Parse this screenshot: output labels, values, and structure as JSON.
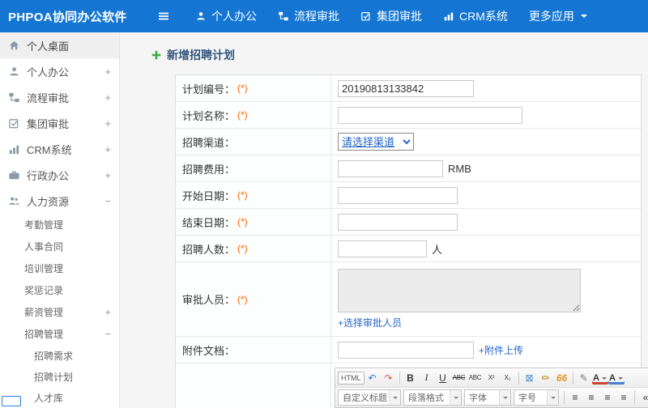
{
  "topbar": {
    "brand": "PHPOA协同办公软件",
    "nav": [
      {
        "label": "个人办公"
      },
      {
        "label": "流程审批"
      },
      {
        "label": "集团审批"
      },
      {
        "label": "CRM系统"
      },
      {
        "label": "更多应用"
      }
    ]
  },
  "sidebar": {
    "items": [
      {
        "label": "个人桌面",
        "expander": ""
      },
      {
        "label": "个人办公",
        "expander": "+"
      },
      {
        "label": "流程审批",
        "expander": "+"
      },
      {
        "label": "集团审批",
        "expander": "+"
      },
      {
        "label": "CRM系统",
        "expander": "+"
      },
      {
        "label": "行政办公",
        "expander": "+"
      },
      {
        "label": "人力资源",
        "expander": "−"
      }
    ],
    "hr_sub": [
      {
        "name": "sidebar-item-attendance",
        "label": "考勤管理",
        "expander": ""
      },
      {
        "name": "sidebar-item-hr-contract",
        "label": "人事合同",
        "expander": ""
      },
      {
        "name": "sidebar-item-training",
        "label": "培训管理",
        "expander": ""
      },
      {
        "name": "sidebar-item-rewards",
        "label": "奖惩记录",
        "expander": ""
      },
      {
        "name": "sidebar-item-salary",
        "label": "薪资管理",
        "expander": "+"
      },
      {
        "name": "sidebar-item-recruitment",
        "label": "招聘管理",
        "expander": "−"
      }
    ],
    "recruit_sub": [
      {
        "name": "sidebar-item-recruit-demand",
        "label": "招聘需求"
      },
      {
        "name": "sidebar-item-recruit-plan",
        "label": "招聘计划"
      },
      {
        "name": "sidebar-item-talent-pool",
        "label": "人才库"
      }
    ]
  },
  "page": {
    "title": "新增招聘计划"
  },
  "form": {
    "rows": {
      "plan_no": {
        "label": "计划编号：",
        "req": "(*)",
        "value": "20190813133842"
      },
      "plan_name": {
        "label": "计划名称：",
        "req": "(*)"
      },
      "channel": {
        "label": "招聘渠道：",
        "select_value": "请选择渠道"
      },
      "cost": {
        "label": "招聘费用：",
        "suffix": "RMB"
      },
      "start_date": {
        "label": "开始日期：",
        "req": "(*)"
      },
      "end_date": {
        "label": "结束日期：",
        "req": "(*)"
      },
      "headcount": {
        "label": "招聘人数：",
        "req": "(*)",
        "suffix": "人"
      },
      "approvers": {
        "label": "审批人员：",
        "req": "(*)",
        "link": "+选择审批人员"
      },
      "attachment": {
        "label": "附件文档：",
        "link": "+附件上传"
      }
    }
  },
  "editor": {
    "row1": [
      {
        "name": "html-source-button",
        "glyph": "HTML",
        "cls": "txt"
      },
      {
        "name": "undo-icon",
        "glyph": "↶",
        "color": "#2a7bd9"
      },
      {
        "name": "redo-icon",
        "glyph": "↷",
        "color": "#e2574c"
      },
      {
        "name": "separator",
        "cls": "sep"
      },
      {
        "name": "bold-icon",
        "glyph": "B",
        "cls": "b"
      },
      {
        "name": "italic-icon",
        "glyph": "I",
        "cls": "i"
      },
      {
        "name": "underline-icon",
        "glyph": "U",
        "cls": "u"
      },
      {
        "name": "strikethrough-icon",
        "glyph": "ABC",
        "cls": "small strike"
      },
      {
        "name": "spellcheck-icon",
        "glyph": "ABC",
        "cls": "small"
      },
      {
        "name": "superscript-icon",
        "glyph": "X²",
        "cls": "small"
      },
      {
        "name": "subscript-icon",
        "glyph": "X₂",
        "cls": "small"
      },
      {
        "name": "separator",
        "cls": "sep"
      },
      {
        "name": "remove-format-icon",
        "glyph": "⊠",
        "color": "#4a90d9"
      },
      {
        "name": "format-brush-icon",
        "glyph": "✏",
        "color": "#b8860b"
      },
      {
        "name": "blockquote-icon",
        "glyph": "66",
        "cls": "quote"
      },
      {
        "name": "separator",
        "cls": "sep"
      },
      {
        "name": "pencil-icon",
        "glyph": "✎",
        "color": "#777777"
      },
      {
        "name": "font-color-icon",
        "glyph": "A",
        "cls": "fontcolor caret"
      },
      {
        "name": "bg-color-icon",
        "glyph": "A",
        "cls": "bgcolor caret"
      }
    ],
    "dropdowns": [
      "自定义标题",
      "段落格式",
      "字体",
      "字号"
    ],
    "row2_icons": [
      {
        "name": "separator",
        "cls": "sep"
      },
      {
        "name": "align-left-icon",
        "glyph": "≡"
      },
      {
        "name": "align-center-icon",
        "glyph": "≡"
      },
      {
        "name": "align-right-icon",
        "glyph": "≡"
      },
      {
        "name": "align-justify-icon",
        "glyph": "≡"
      },
      {
        "name": "separator",
        "cls": "sep"
      },
      {
        "name": "indent-decrease-icon",
        "glyph": "«"
      },
      {
        "name": "indent-increase-icon",
        "glyph": "»"
      }
    ]
  },
  "colors": {
    "topbar_blue": "#1476d2",
    "link_blue": "#2567cb",
    "required_orange": "#ff6600",
    "add_green": "#3fae49",
    "title_navy": "#33567e"
  }
}
